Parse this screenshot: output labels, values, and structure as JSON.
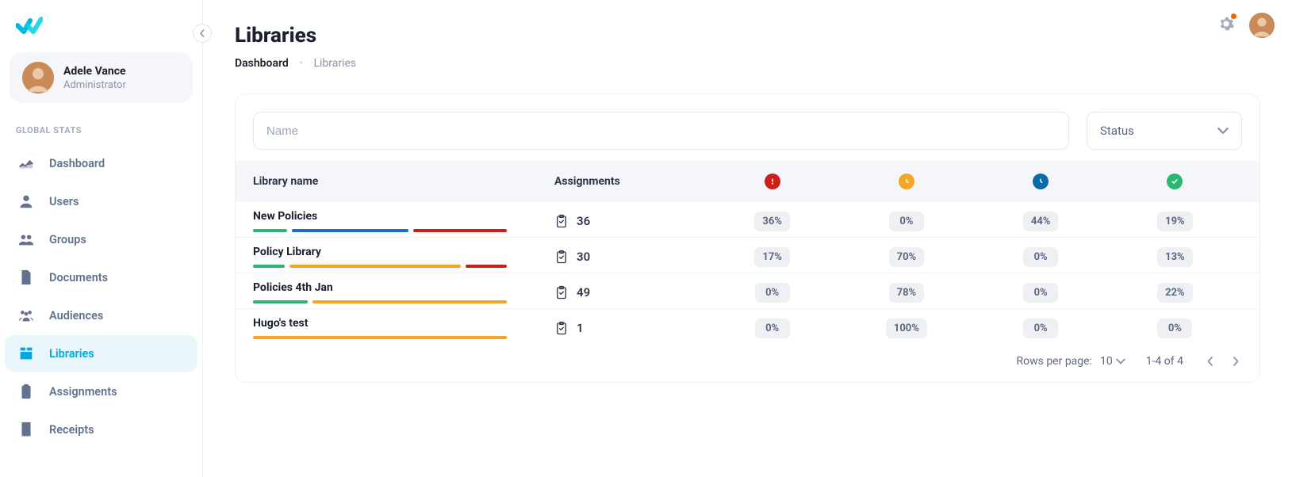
{
  "user": {
    "name": "Adele Vance",
    "role": "Administrator"
  },
  "sidebar": {
    "section_title": "GLOBAL STATS",
    "items": [
      {
        "label": "Dashboard",
        "icon": "chart-icon"
      },
      {
        "label": "Users",
        "icon": "user-icon"
      },
      {
        "label": "Groups",
        "icon": "group-icon"
      },
      {
        "label": "Documents",
        "icon": "document-icon"
      },
      {
        "label": "Audiences",
        "icon": "audience-icon"
      },
      {
        "label": "Libraries",
        "icon": "library-icon"
      },
      {
        "label": "Assignments",
        "icon": "clipboard-icon"
      },
      {
        "label": "Receipts",
        "icon": "receipt-icon"
      }
    ],
    "active_index": 5
  },
  "page": {
    "title": "Libraries",
    "breadcrumb": [
      {
        "label": "Dashboard",
        "active": true
      },
      {
        "label": "Libraries",
        "active": false
      }
    ]
  },
  "filters": {
    "name_placeholder": "Name",
    "status_label": "Status"
  },
  "table": {
    "columns": {
      "library_name": "Library name",
      "assignments": "Assignments"
    },
    "rows": [
      {
        "name": "New Policies",
        "assignments": 36,
        "overdue_pct": "36%",
        "pending_pct": "0%",
        "inprogress_pct": "44%",
        "complete_pct": "19%",
        "segments": [
          {
            "color": "green",
            "flex": 13
          },
          {
            "color": "blue",
            "flex": 45
          },
          {
            "color": "red",
            "flex": 36
          }
        ]
      },
      {
        "name": "Policy Library",
        "assignments": 30,
        "overdue_pct": "17%",
        "pending_pct": "70%",
        "inprogress_pct": "0%",
        "complete_pct": "13%",
        "segments": [
          {
            "color": "green",
            "flex": 13
          },
          {
            "color": "yellow",
            "flex": 70
          },
          {
            "color": "red",
            "flex": 17
          }
        ]
      },
      {
        "name": "Policies 4th Jan",
        "assignments": 49,
        "overdue_pct": "0%",
        "pending_pct": "78%",
        "inprogress_pct": "0%",
        "complete_pct": "22%",
        "segments": [
          {
            "color": "green",
            "flex": 22
          },
          {
            "color": "yellow",
            "flex": 78
          }
        ]
      },
      {
        "name": "Hugo's test",
        "assignments": 1,
        "overdue_pct": "0%",
        "pending_pct": "100%",
        "inprogress_pct": "0%",
        "complete_pct": "0%",
        "segments": [
          {
            "color": "yellow",
            "flex": 100
          }
        ]
      }
    ]
  },
  "pagination": {
    "rows_label": "Rows per page:",
    "rows_value": "10",
    "range": "1-4 of 4"
  }
}
